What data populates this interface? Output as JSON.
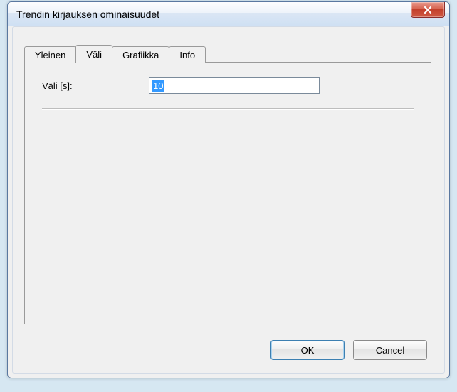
{
  "window": {
    "title": "Trendin kirjauksen ominaisuudet"
  },
  "tabs": {
    "general": "Yleinen",
    "interval": "Väli",
    "graphics": "Grafiikka",
    "info": "Info",
    "active": "interval"
  },
  "interval_tab": {
    "label": "Väli [s]:",
    "value": "10"
  },
  "buttons": {
    "ok": "OK",
    "cancel": "Cancel"
  }
}
